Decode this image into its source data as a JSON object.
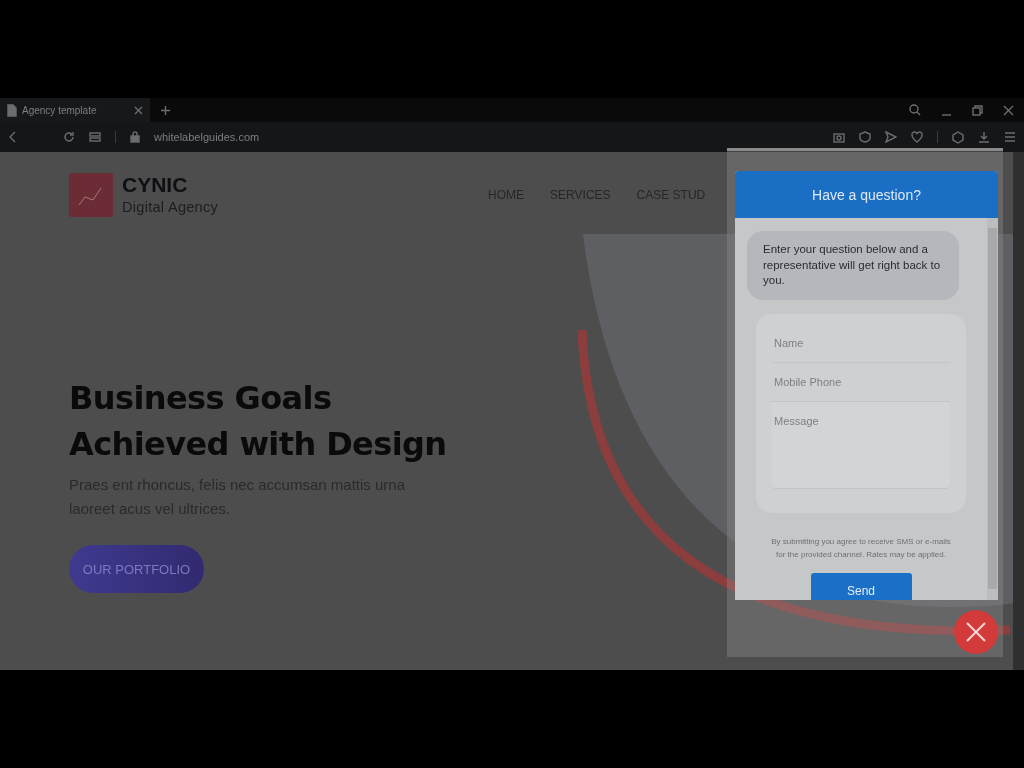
{
  "browser": {
    "tab_title": "Agency template",
    "url": "whitelabelguides.com"
  },
  "site": {
    "logo_title": "CYNIC",
    "logo_subtitle": "Digital Agency",
    "nav": [
      "HOME",
      "SERVICES",
      "CASE STUD"
    ],
    "headline_lines": [
      "Business Goals",
      "Achieved with Design"
    ],
    "intro": "Praes ent rhoncus, felis nec accumsan mattis urna laoreet acus vel ultrices.",
    "cta": "OUR PORTFOLIO"
  },
  "chat": {
    "title": "Have a question?",
    "greeting": "Enter your question below and a representative will get right back to you.",
    "fields": [
      {
        "placeholder": "Name",
        "kind": "line"
      },
      {
        "placeholder": "Mobile Phone",
        "kind": "line"
      },
      {
        "placeholder": "Message",
        "kind": "area"
      }
    ],
    "disclaimer": "By submitting you agree to receive SMS or e-mails for the provided channel. Rates may be applied.",
    "send": "Send"
  }
}
